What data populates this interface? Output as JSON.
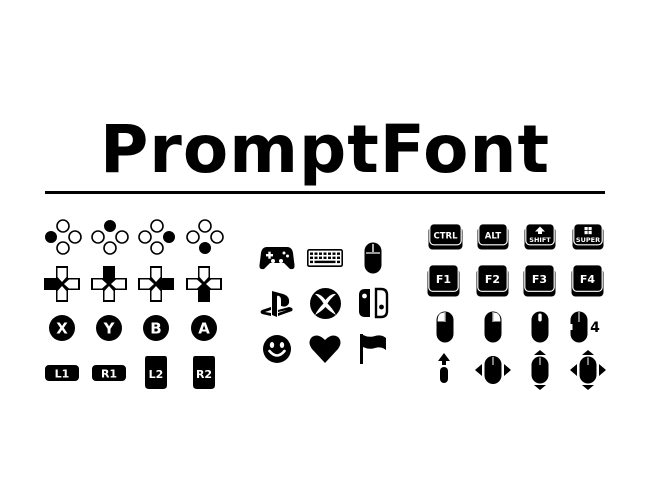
{
  "title": "PromptFont",
  "face_buttons": {
    "x": "X",
    "y": "Y",
    "b": "B",
    "a": "A"
  },
  "shoulders": {
    "l1": "L1",
    "r1": "R1",
    "l2": "L2",
    "r2": "R2"
  },
  "keys": {
    "ctrl": "CTRL",
    "alt": "ALT",
    "shift": "SHIFT",
    "super": "SUPER",
    "f1": "F1",
    "f2": "F2",
    "f3": "F3",
    "f4": "F4"
  },
  "mouse_suffix": "4",
  "colors": {
    "ink": "#000000",
    "paper": "#ffffff"
  }
}
